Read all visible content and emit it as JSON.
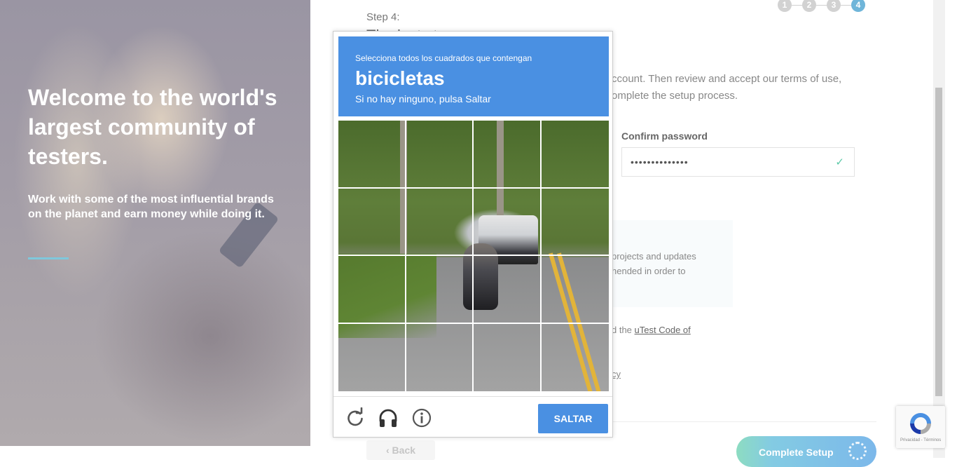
{
  "hero": {
    "title": "Welcome to the world's largest community of testers.",
    "subtitle": "Work with some of the most influential brands on the planet and earn money while doing it.",
    "accent_color": "#7fc8dc"
  },
  "wizard": {
    "step_label": "Step 4:",
    "step_title": "The last step",
    "steps": [
      "1",
      "2",
      "3",
      "4"
    ],
    "active_step": 4
  },
  "form": {
    "intro_line1": "ccount. Then review and accept our terms of use,",
    "intro_line2": "omplete the setup process.",
    "confirm_password_label": "Confirm password",
    "confirm_password_value": "••••••••••••••",
    "info_line1": "projects and updates",
    "info_line2": "hended in order to",
    "terms_prefix": "d the",
    "terms_link": "uTest Code of",
    "privacy_fragment": "cy",
    "back_label": "Back",
    "complete_label": "Complete Setup"
  },
  "captcha": {
    "instruction": "Selecciona todos los cuadrados que contengan",
    "object": "bicicletas",
    "skip_hint": "Si no hay ninguno, pulsa Saltar",
    "skip_button": "SALTAR",
    "header_color": "#4a90e2",
    "icons": [
      "reload-icon",
      "audio-headphones-icon",
      "info-icon"
    ]
  },
  "recaptcha_badge": {
    "text": "Privacidad - Términos"
  }
}
